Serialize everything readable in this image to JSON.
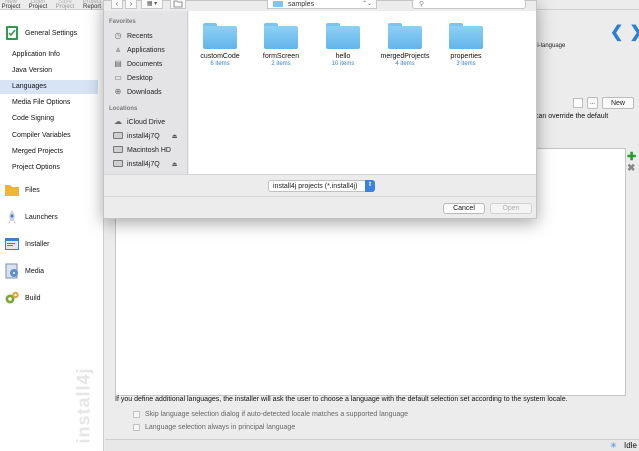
{
  "toolbar": {
    "buttons": [
      {
        "line1": "New",
        "line2": "Project"
      },
      {
        "line1": "Open",
        "line2": "Project"
      },
      {
        "line1": "Save",
        "line2": "Project"
      },
      {
        "line1": "Project",
        "line2": "Report"
      }
    ]
  },
  "sidebar": {
    "general_settings": "General Settings",
    "items": [
      {
        "label": "Application Info"
      },
      {
        "label": "Java Version"
      },
      {
        "label": "Languages"
      },
      {
        "label": "Media File Options"
      },
      {
        "label": "Code Signing"
      },
      {
        "label": "Compiler Variables"
      },
      {
        "label": "Merged Projects"
      },
      {
        "label": "Project Options"
      }
    ],
    "sections": [
      {
        "label": "Files"
      },
      {
        "label": "Launchers"
      },
      {
        "label": "Installer"
      },
      {
        "label": "Media"
      },
      {
        "label": "Build"
      }
    ],
    "watermark": "install4j"
  },
  "main": {
    "multi_language": "ulti-language",
    "new_label": "New",
    "dots_label": "...",
    "override_text": "can override the default",
    "info_text": "If you define additional languages, the installer will ask the user to choose a language with the default selection set according to the system locale.",
    "checkbox1": "Skip language selection dialog if auto-detected locale matches a supported language",
    "checkbox2": "Language selection always in principal language"
  },
  "status": {
    "text": "Idle"
  },
  "dialog": {
    "location": "samples",
    "sidebar": {
      "favorites_header": "Favorites",
      "favorites": [
        {
          "label": "Recents",
          "icon": "clock-icon"
        },
        {
          "label": "Applications",
          "icon": "applications-icon"
        },
        {
          "label": "Documents",
          "icon": "document-icon"
        },
        {
          "label": "Desktop",
          "icon": "desktop-icon"
        },
        {
          "label": "Downloads",
          "icon": "download-icon"
        }
      ],
      "locations_header": "Locations",
      "locations": [
        {
          "label": "iCloud Drive",
          "icon": "cloud-icon"
        },
        {
          "label": "install4j7Q",
          "icon": "disk-icon",
          "eject": "⏏"
        },
        {
          "label": "Macintosh HD",
          "icon": "disk-icon"
        },
        {
          "label": "install4j7Q",
          "icon": "disk-icon",
          "eject": "⏏"
        }
      ]
    },
    "files": [
      {
        "name": "customCode",
        "count": "6 items"
      },
      {
        "name": "formScreen",
        "count": "2 items"
      },
      {
        "name": "hello",
        "count": "10 items"
      },
      {
        "name": "mergedProjects",
        "count": "4 items"
      },
      {
        "name": "properties",
        "count": "3 items"
      }
    ],
    "filter": "install4j projects (*.install4j)",
    "cancel_label": "Cancel",
    "open_label": "Open"
  }
}
